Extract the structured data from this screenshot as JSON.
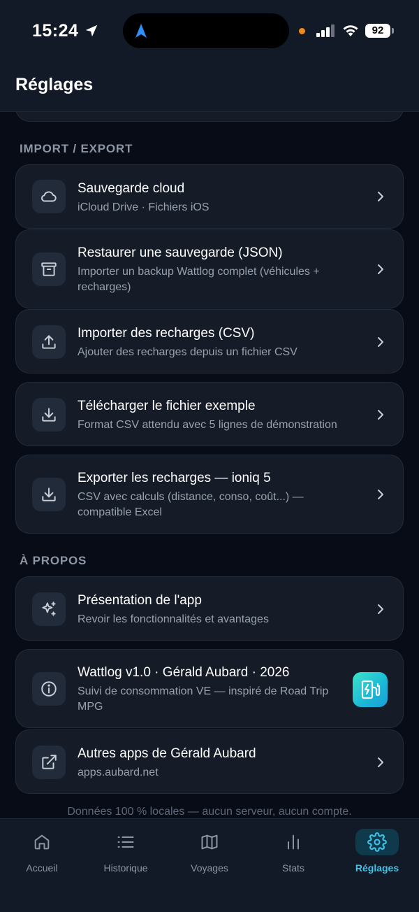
{
  "status": {
    "time": "15:24",
    "battery": "92"
  },
  "header": {
    "title": "Réglages"
  },
  "sections": {
    "import_export": "IMPORT / EXPORT",
    "about": "À PROPOS"
  },
  "items": [
    {
      "title": "Sauvegarde cloud",
      "subtitle": "iCloud Drive · Fichiers iOS",
      "icon": "cloud-icon"
    },
    {
      "title": "Restaurer une sauvegarde (JSON)",
      "subtitle": "Importer un backup Wattlog complet (véhicules + recharges)",
      "icon": "archive-icon"
    },
    {
      "title": "Importer des recharges (CSV)",
      "subtitle": "Ajouter des recharges depuis un fichier CSV",
      "icon": "upload-icon"
    },
    {
      "title": "Télécharger le fichier exemple",
      "subtitle": "Format CSV attendu avec 5 lignes de démonstration",
      "icon": "download-icon"
    },
    {
      "title": "Exporter les recharges — ioniq 5",
      "subtitle": "CSV avec calculs (distance, conso, coût...) — compatible Excel",
      "icon": "download-icon"
    },
    {
      "title": "Présentation de l'app",
      "subtitle": "Revoir les fonctionnalités et avantages",
      "icon": "sparkles-icon"
    },
    {
      "title": "Wattlog v1.0 · Gérald Aubard · 2026",
      "subtitle": "Suivi de consommation VE — inspiré de Road Trip MPG",
      "icon": "info-icon"
    },
    {
      "title": "Autres apps de Gérald Aubard",
      "subtitle": "apps.aubard.net",
      "icon": "external-link-icon"
    }
  ],
  "footer": {
    "note": "Données 100 % locales — aucun serveur, aucun compte."
  },
  "tabs": [
    {
      "label": "Accueil",
      "icon": "home-icon"
    },
    {
      "label": "Historique",
      "icon": "list-icon"
    },
    {
      "label": "Voyages",
      "icon": "map-icon"
    },
    {
      "label": "Stats",
      "icon": "bar-chart-icon"
    },
    {
      "label": "Réglages",
      "icon": "gear-icon",
      "active": true
    }
  ],
  "colors": {
    "accent": "#3fc3ea",
    "background": "#070c17",
    "card": "#151c28"
  }
}
